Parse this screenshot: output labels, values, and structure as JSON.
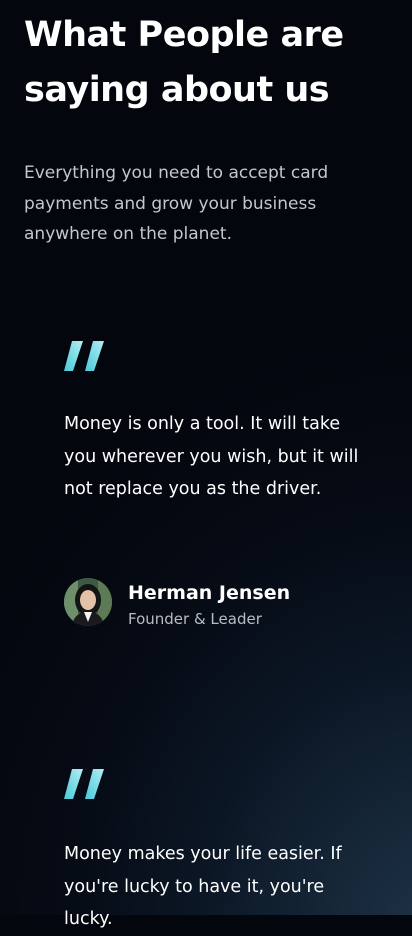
{
  "section": {
    "heading_line1": "What People are",
    "heading_line2": "saying about us",
    "intro": "Everything you need to accept card payments and grow your business anywhere on the planet."
  },
  "testimonials": [
    {
      "quote": "Money is only a tool. It will take you wherever you wish, but it will not replace you as the driver.",
      "author_name": "Herman Jensen",
      "author_role": "Founder & Leader"
    },
    {
      "quote": "Money makes your life easier. If you're lucky to have it, you're lucky."
    }
  ],
  "colors": {
    "quote_mark_start": "#5fd9e6",
    "quote_mark_end": "#9fe9f0",
    "background": "#03060d"
  },
  "icons": {
    "quote_mark": "double-quote-icon"
  }
}
